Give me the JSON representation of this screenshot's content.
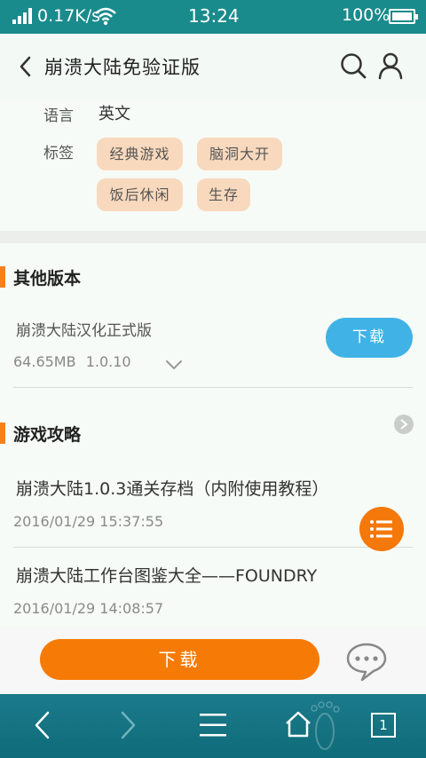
{
  "status_bar": {
    "net_speed": "0.17K/s",
    "time": "13:24",
    "battery": "100%",
    "color": "#1a8b8c"
  },
  "header": {
    "title": "崩溃大陆免验证版",
    "back_icon": "chevron-left-icon",
    "search_icon": "search-icon",
    "user_icon": "user-icon"
  },
  "info": {
    "language_label": "语言",
    "language_value": "英文",
    "tags_label": "标签",
    "tags": [
      "经典游戏",
      "脑洞大开",
      "饭后休闲",
      "生存"
    ]
  },
  "other_versions": {
    "title": "其他版本",
    "items": [
      {
        "name": "崩溃大陆汉化正式版",
        "size": "64.65MB",
        "version": "1.0.10",
        "download_label": "下载"
      }
    ]
  },
  "guides": {
    "title": "游戏攻略",
    "articles": [
      {
        "title": "崩溃大陆1.0.3通关存档（内附使用教程）",
        "date": "2016/01/29 15:37:55"
      },
      {
        "title": "崩溃大陆工作台图鉴大全——FOUNDRY",
        "date": "2016/01/29 14:08:57"
      }
    ]
  },
  "bottom": {
    "download_label": "下载",
    "chat_icon": "chat-bubble-icon"
  },
  "nav_bar": {
    "tab_count": "1"
  },
  "colors": {
    "accent_orange": "#f57b06",
    "download_blue": "#41b2e6",
    "tag_bg": "#f8d9bd"
  }
}
